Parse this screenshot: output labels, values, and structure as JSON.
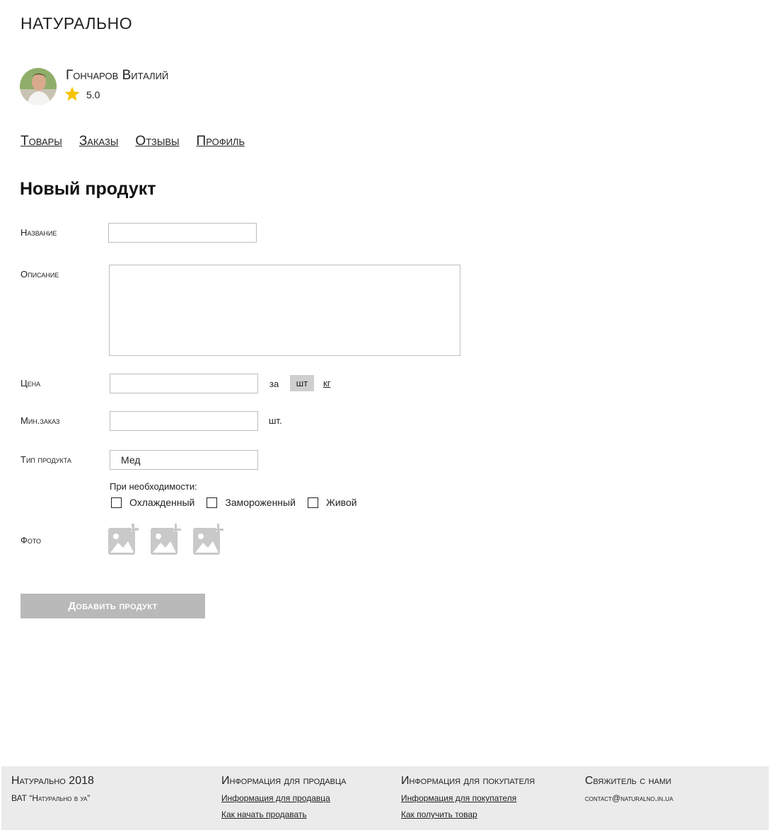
{
  "brand": {
    "logo": "НАТУРАЛЬНО"
  },
  "user": {
    "name": "Гончаров Виталий",
    "rating": "5.0",
    "avatar_icon": "user-avatar",
    "star_icon": "star-icon",
    "star_color": "#F5C400"
  },
  "nav": [
    {
      "label": "Товары"
    },
    {
      "label": "Заказы"
    },
    {
      "label": "Отзывы"
    },
    {
      "label": "Профиль"
    }
  ],
  "form": {
    "title": "Новый продукт",
    "name_label": "Название",
    "name_value": "",
    "description_label": "Описание",
    "description_value": "",
    "price_label": "Цена",
    "price_value": "",
    "price_per": "за",
    "unit_options": [
      "шт",
      "кг"
    ],
    "unit_selected": "шт",
    "min_order_label": "Мин.заказ",
    "min_order_value": "",
    "min_order_unit": "шт.",
    "product_type_label": "Тип продукта",
    "product_type_value": "Мед",
    "if_needed": "При необходимости:",
    "options": [
      {
        "label": "Охлажденный",
        "checked": false
      },
      {
        "label": "Замороженный",
        "checked": false
      },
      {
        "label": "Живой",
        "checked": false
      }
    ],
    "photo_label": "Фото",
    "photo_icon": "add-photo-icon",
    "photo_slots": 3,
    "submit_label": "Добавить продукт"
  },
  "footer": {
    "col1": {
      "title": "Натурально 2018",
      "text": "ВАТ “Натурально в уа”"
    },
    "col2": {
      "title": "Информация для продавца",
      "links": [
        "Информация для продавца",
        "Как начать продавать"
      ]
    },
    "col3": {
      "title": "Информация для покупателя",
      "links": [
        "Информация для покупателя",
        "Как получить товар"
      ]
    },
    "col4": {
      "title": "Свяжитель с нами",
      "email": "contact@naturalno.in.ua"
    }
  },
  "colors": {
    "accent_gray": "#B9B9B9",
    "footer_bg": "#EBEBEB",
    "star": "#F5C400"
  }
}
